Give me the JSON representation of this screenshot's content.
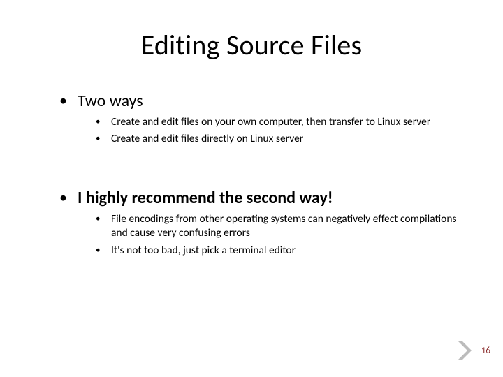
{
  "title": "Editing Source Files",
  "bullets": {
    "b1": {
      "label": "Two ways"
    },
    "b1_subs": [
      "Create and edit files on your own computer, then transfer to Linux server",
      "Create and edit files directly on Linux server"
    ],
    "b2": {
      "label": "I highly recommend the second way!"
    },
    "b2_subs": [
      "File encodings from other operating systems can negatively effect compilations and cause very confusing errors",
      "It's not too bad, just pick a terminal editor"
    ]
  },
  "page_number": "16",
  "colors": {
    "accent": "#8a2a2a",
    "chevron": "#b9b9b9"
  }
}
